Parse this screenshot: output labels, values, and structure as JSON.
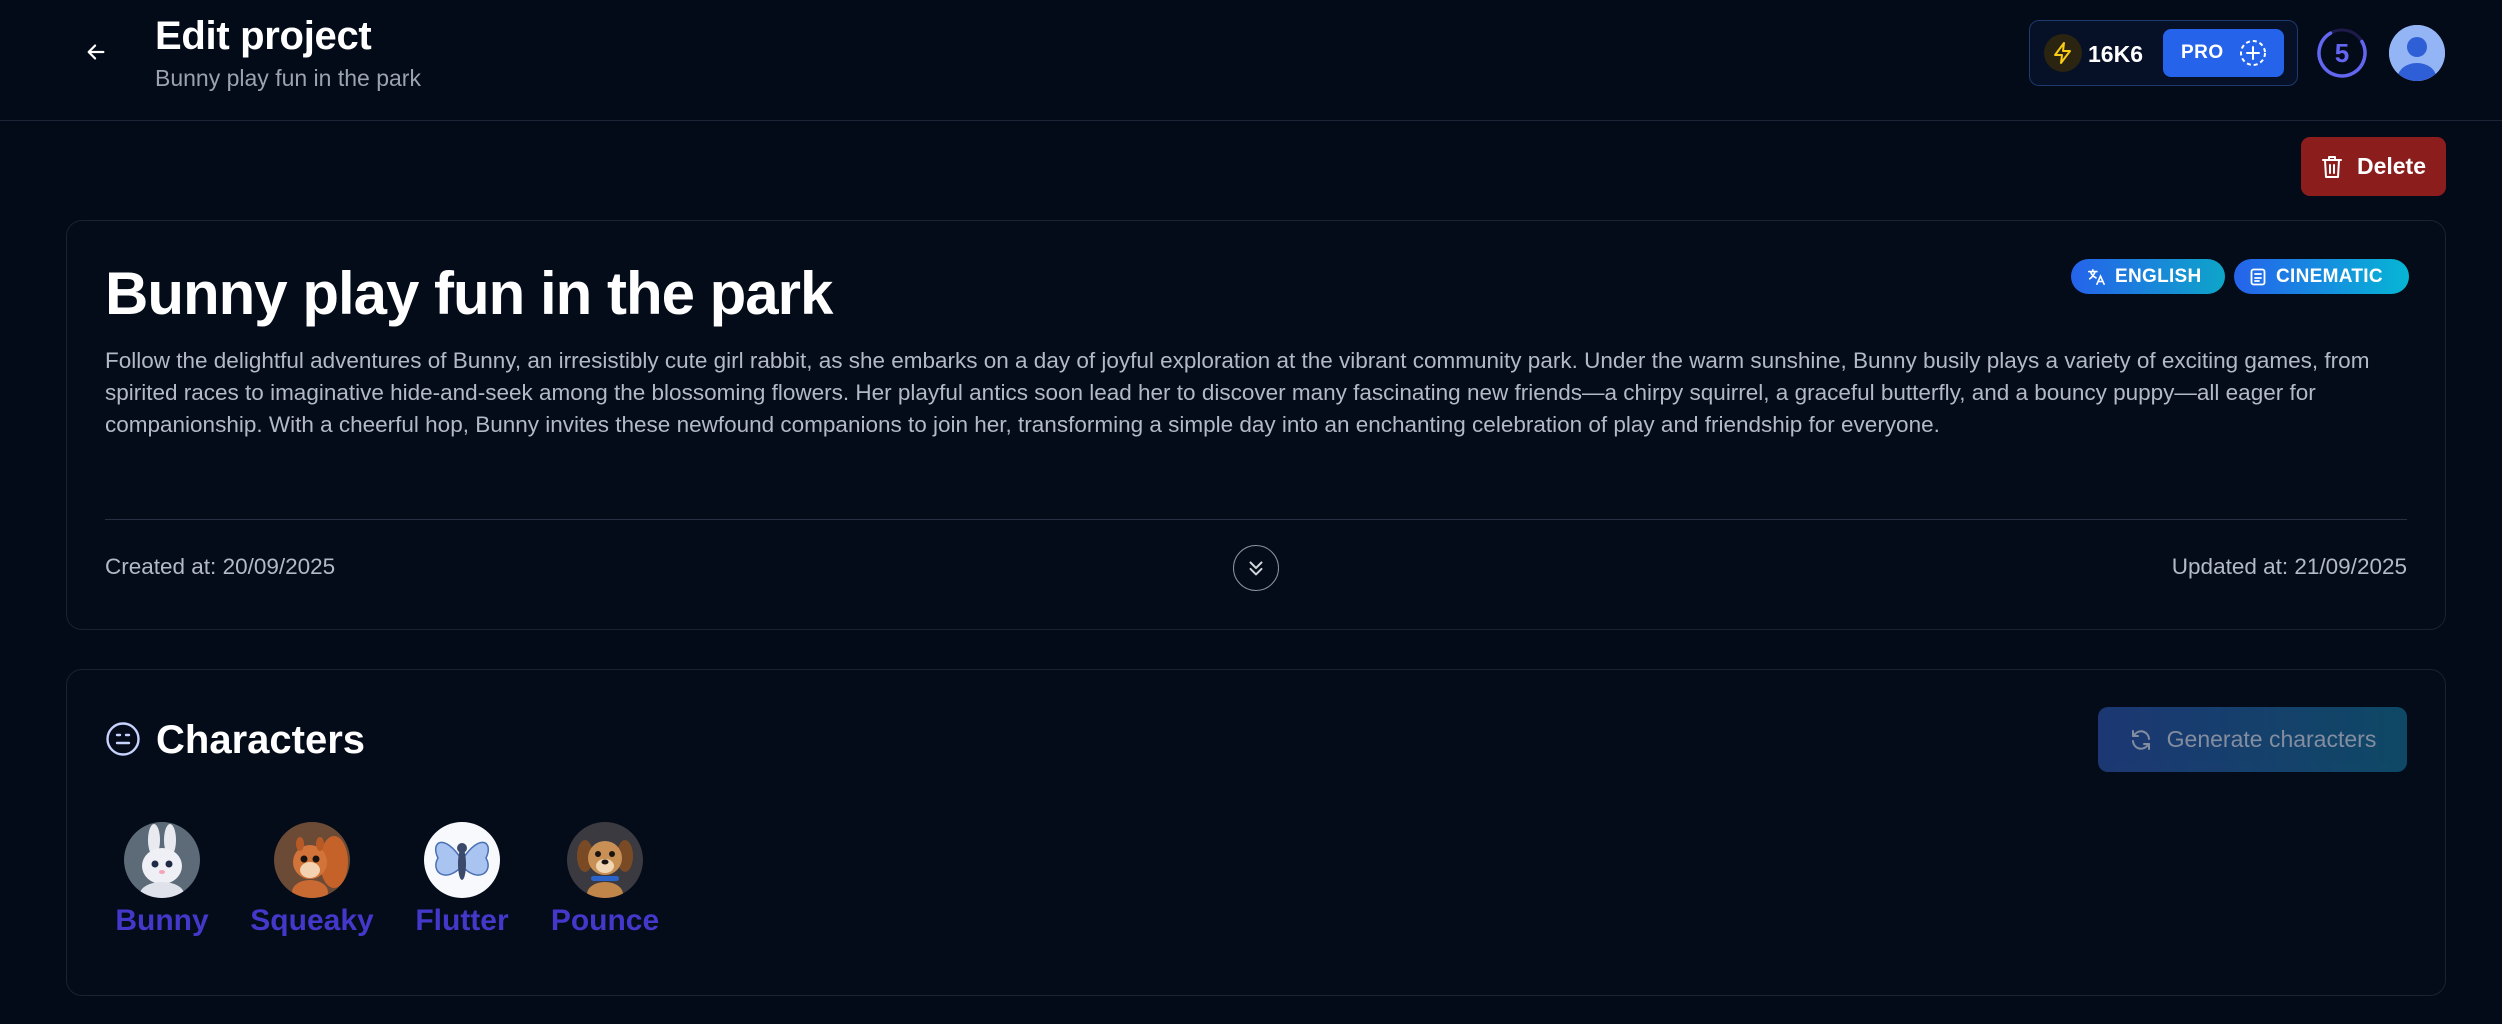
{
  "header": {
    "title": "Edit project",
    "subtitle": "Bunny play fun in the park",
    "back_icon": "arrow-left-icon"
  },
  "account": {
    "credits": "16K6",
    "plan_label": "PRO",
    "notification_count": "5",
    "colors": {
      "pro_bg": "#2563eb",
      "bolt": "#facc15",
      "ring": "#6366f1"
    }
  },
  "actions": {
    "delete_label": "Delete",
    "delete_color": "#8b1d1d"
  },
  "project": {
    "title": "Bunny play fun in the park",
    "tags": [
      {
        "label": "ENGLISH",
        "icon": "translate-icon"
      },
      {
        "label": "CINEMATIC",
        "icon": "film-icon"
      }
    ],
    "description": "Follow the delightful adventures of Bunny, an irresistibly cute girl rabbit, as she embarks on a day of joyful exploration at the vibrant community park. Under the warm sunshine, Bunny busily plays a variety of exciting games, from spirited races to imaginative hide-and-seek among the blossoming flowers. Her playful antics soon lead her to discover many fascinating new friends—a chirpy squirrel, a graceful butterfly, and a bouncy puppy—all eager for companionship. With a cheerful hop, Bunny invites these newfound companions to join her, transforming a simple day into an enchanting celebration of play and friendship for everyone.",
    "created_at": "Created at: 20/09/2025",
    "updated_at": "Updated at: 21/09/2025"
  },
  "characters": {
    "title": "Characters",
    "generate_label": "Generate characters",
    "name_color": "#4338ca",
    "items": [
      {
        "name": "Bunny"
      },
      {
        "name": "Squeaky"
      },
      {
        "name": "Flutter"
      },
      {
        "name": "Pounce"
      }
    ]
  }
}
